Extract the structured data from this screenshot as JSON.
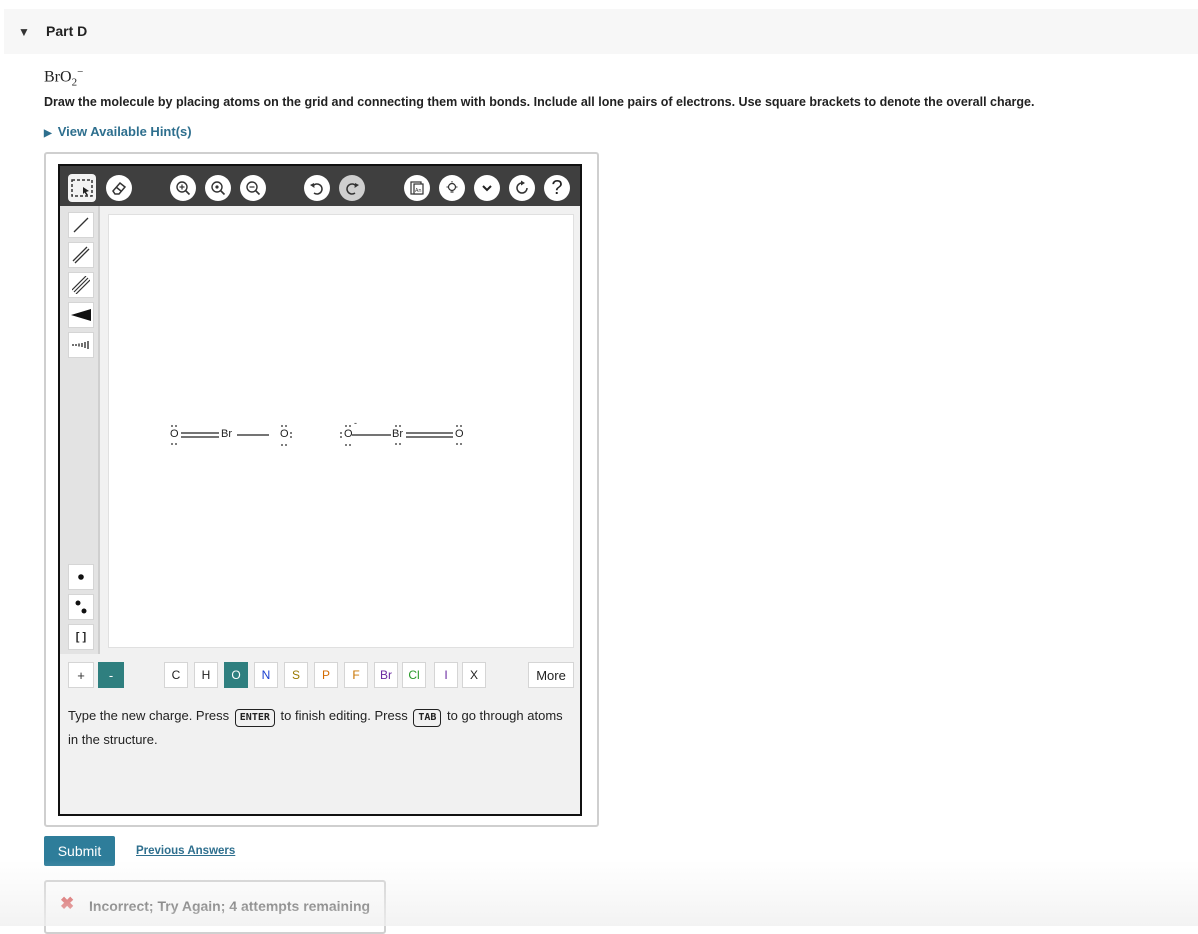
{
  "part": {
    "toggle_icon": "caret-down-icon",
    "title": "Part D"
  },
  "question": {
    "formula_main": "BrO",
    "formula_sub": "2",
    "formula_sup": "−",
    "instructions": "Draw the molecule by placing atoms on the grid and connecting them with bonds. Include all lone pairs of electrons. Use square brackets to denote the overall charge.",
    "hint_link": "View Available Hint(s)"
  },
  "toolbar": {
    "icons": [
      "select-icon",
      "eraser-icon",
      "zoom-in-icon",
      "zoom-reset-icon",
      "zoom-out-icon",
      "undo-icon",
      "redo-icon",
      "template-icon",
      "lightbulb-icon",
      "chevron-down-icon",
      "cleanup-icon",
      "help-icon"
    ],
    "help_label": "?"
  },
  "sidebar": {
    "tools": [
      "single-bond-icon",
      "double-bond-icon",
      "triple-bond-icon",
      "wedge-bond-icon",
      "hash-bond-icon",
      "radical-icon",
      "lone-pair-icon",
      "brackets-icon"
    ],
    "brackets_label": "[ ]"
  },
  "molecules": [
    {
      "left_atom": "O",
      "center_atom": "Br",
      "right_atom": "O"
    },
    {
      "left_atom": "O",
      "left_charge": "-",
      "center_atom": "Br",
      "right_atom": "O"
    }
  ],
  "charges": {
    "plus": "+",
    "minus": "-"
  },
  "elements": [
    {
      "symbol": "C",
      "color": "#222222"
    },
    {
      "symbol": "H",
      "color": "#222222"
    },
    {
      "symbol": "O",
      "color": "#ffffff",
      "active": true
    },
    {
      "symbol": "N",
      "color": "#1a3fd0"
    },
    {
      "symbol": "S",
      "color": "#9a7a00"
    },
    {
      "symbol": "P",
      "color": "#d36a00"
    },
    {
      "symbol": "F",
      "color": "#c87400"
    },
    {
      "symbol": "Br",
      "color": "#6a2aa0"
    },
    {
      "symbol": "Cl",
      "color": "#2a9a2a"
    },
    {
      "symbol": "I",
      "color": "#6a2aa0"
    },
    {
      "symbol": "X",
      "color": "#222222"
    }
  ],
  "more_label": "More",
  "message": {
    "part1": "Type the new charge. Press",
    "key1": "ENTER",
    "part2": "to finish editing. Press",
    "key2": "TAB",
    "part3": "to go through atoms in the structure."
  },
  "actions": {
    "submit": "Submit",
    "previous": "Previous Answers"
  },
  "feedback": {
    "icon": "x-icon",
    "text": "Incorrect; Try Again; 4 attempts remaining"
  },
  "colors": {
    "accent": "#2e7d9a",
    "link": "#2e6f8e",
    "active_element": "#2f7f7f",
    "error": "#d02a2a"
  }
}
